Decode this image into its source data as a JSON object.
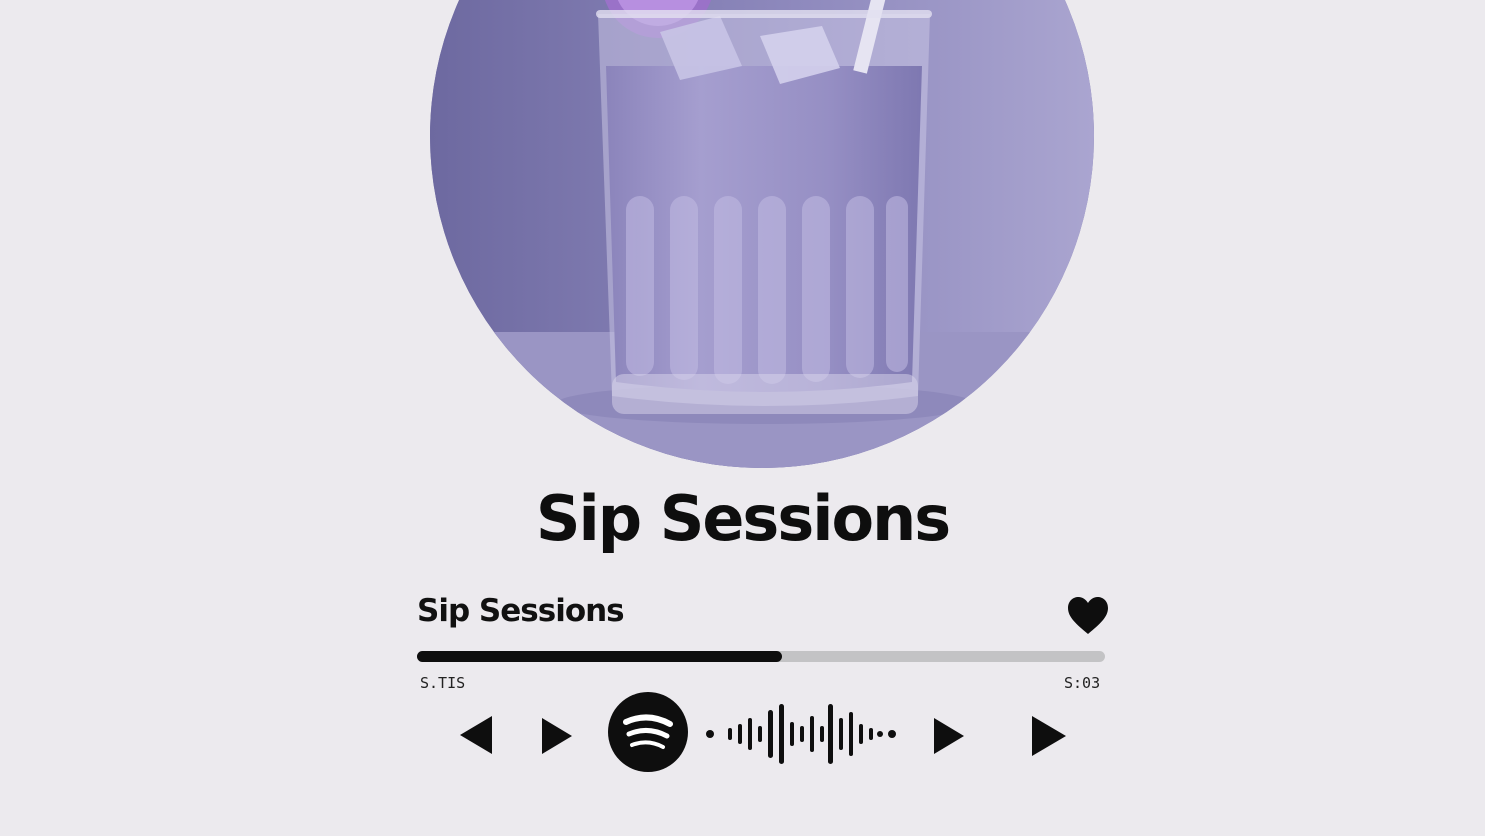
{
  "cover": {
    "background": "#7672a6",
    "drink_color": "#9c95c6"
  },
  "title": "Sip Sessions",
  "player": {
    "track_title": "Sip Sessions",
    "liked": true,
    "progress_fraction": 0.53,
    "elapsed": "S.TIS",
    "total": "S:03",
    "accent": "#0e0e0e",
    "track_color": "#c3c3c5"
  },
  "controls": {
    "previous": "chevron-left-icon",
    "play": "play-icon",
    "brand": "spotify-logo-icon",
    "waveform": "waveform-icon",
    "play_next": "play-icon",
    "skip": "play-icon"
  }
}
